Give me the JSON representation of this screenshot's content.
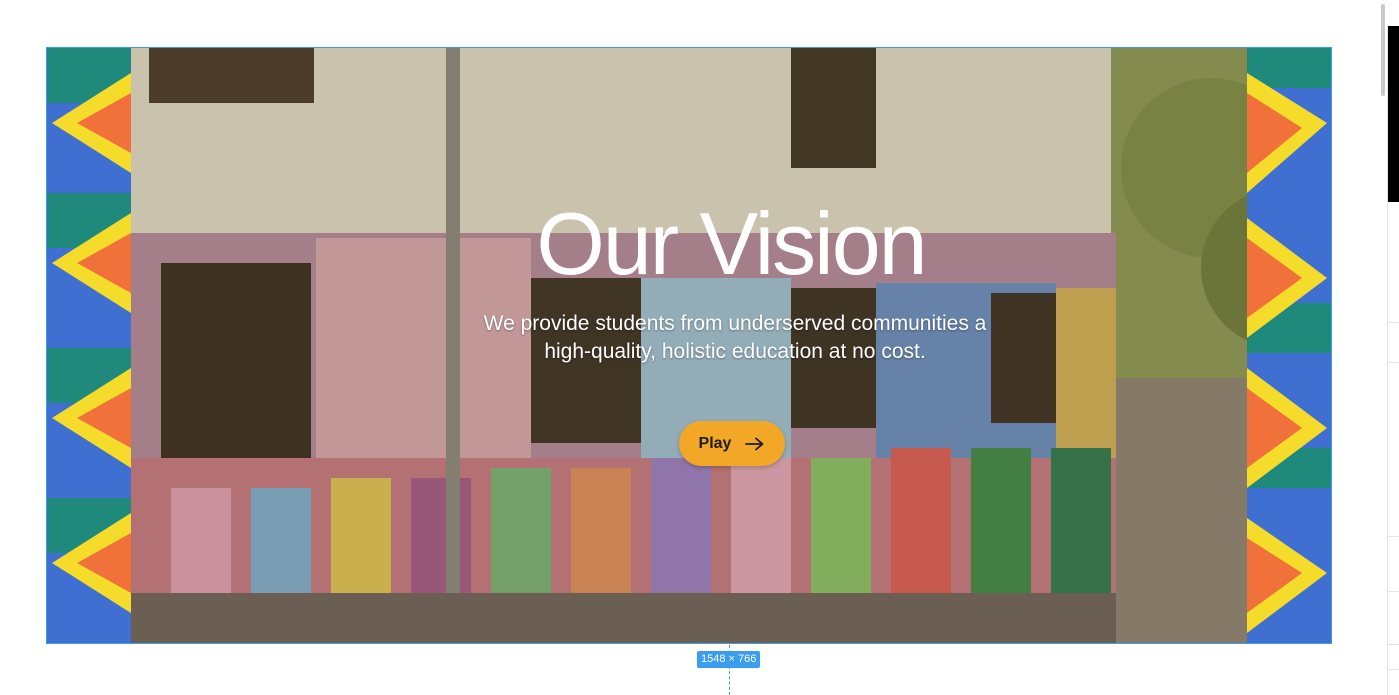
{
  "hero": {
    "title": "Our Vision",
    "subtitle": "We provide students from underserved communities a high-quality, holistic education at no cost.",
    "play_label": "Play"
  },
  "selection": {
    "size_label": "1548 × 766"
  },
  "colors": {
    "selection_outline": "#3b9df0",
    "play_button": "#f2a726",
    "band_blue": "#3f6fd0",
    "band_green": "#1f8a7c",
    "band_yellow": "#f6dc2a",
    "band_orange": "#f0723a"
  }
}
